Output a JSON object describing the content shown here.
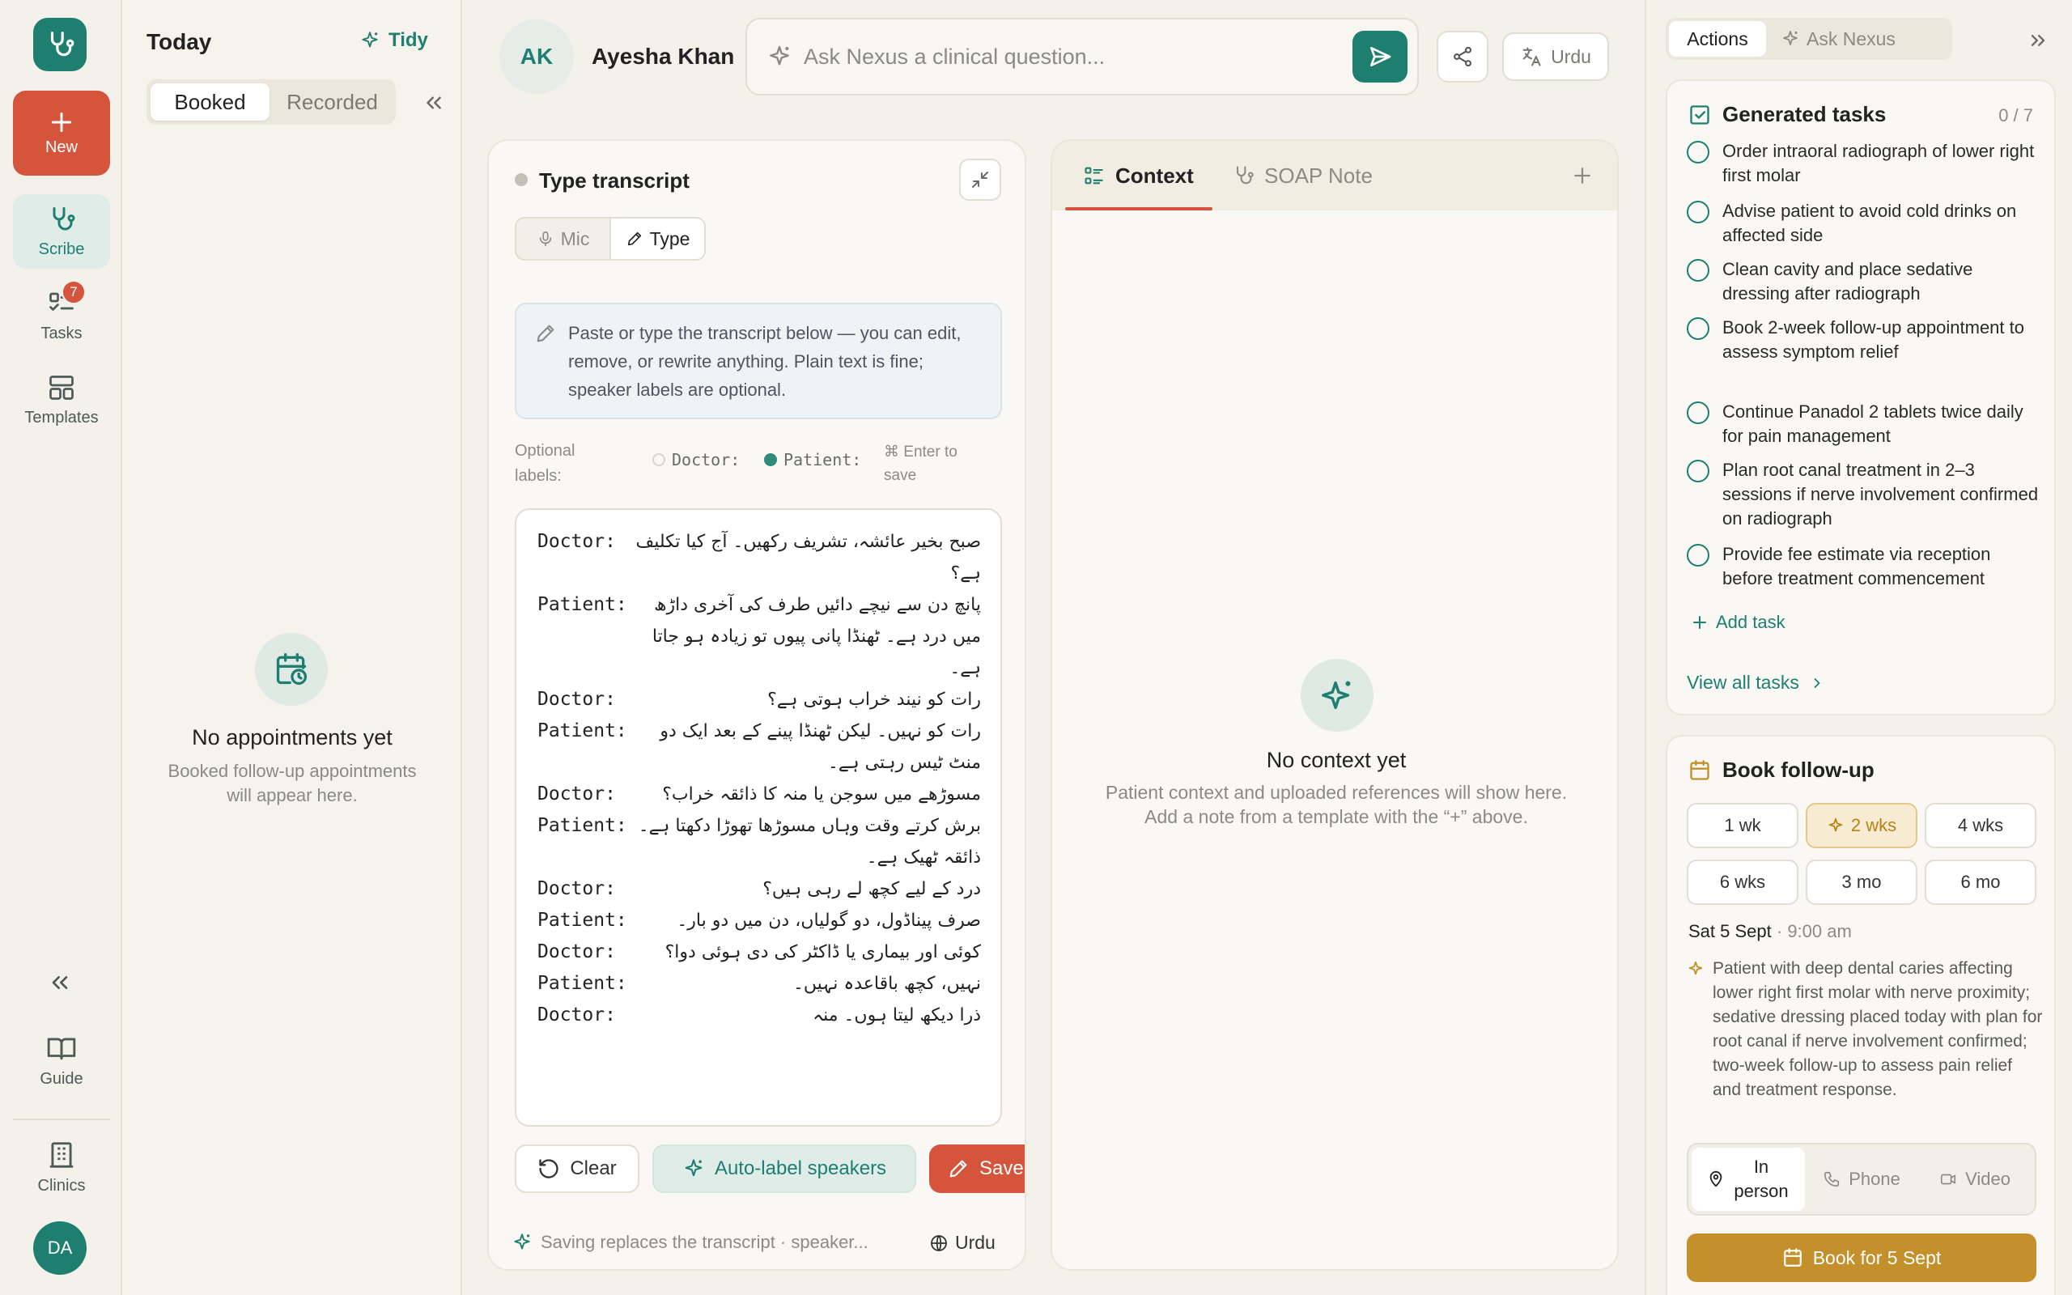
{
  "colors": {
    "brand": "#1e7f70",
    "accent": "#d4553b",
    "gold": "#c3902c",
    "background": "#f4f1ea"
  },
  "rail": {
    "new_label": "New",
    "items": [
      {
        "label": "Scribe",
        "icon": "stethoscope-icon",
        "active": true
      },
      {
        "label": "Tasks",
        "icon": "tasks-icon",
        "badge": "7"
      },
      {
        "label": "Templates",
        "icon": "templates-icon"
      }
    ],
    "guide_label": "Guide",
    "clinics_label": "Clinics",
    "user_initials": "DA"
  },
  "today": {
    "title": "Today",
    "tidy_label": "Tidy",
    "tabs": [
      "Booked",
      "Recorded"
    ],
    "selected_tab": "Booked",
    "empty_title": "No appointments yet",
    "empty_sub": "Booked follow-up appointments will appear here."
  },
  "header": {
    "patient_initials": "AK",
    "patient_name": "Ayesha Khan",
    "ask_placeholder": "Ask Nexus a clinical question...",
    "language": "Urdu"
  },
  "transcript": {
    "title": "Type transcript",
    "modes": [
      "Mic",
      "Type"
    ],
    "active_mode": "Type",
    "hint": "Paste or type the transcript below — you can edit, remove, or rewrite anything. Plain text is fine; speaker labels are optional.",
    "optional_labels": "Optional labels:",
    "label_doctor": "Doctor:",
    "label_patient": "Patient:",
    "save_shortcut": "⌘ Enter to save",
    "lines": [
      {
        "speaker": "Doctor:",
        "text": "صبح بخیر عائشہ، تشریف رکھیں۔ آج کیا تکلیف ہے؟"
      },
      {
        "speaker": "Patient:",
        "text": "پانچ دن سے نیچے دائیں طرف کی آخری داڑھ میں درد ہے۔ ٹھنڈا پانی پیوں تو زیادہ ہو جاتا ہے۔"
      },
      {
        "speaker": "Doctor:",
        "text": "رات کو نیند خراب ہوتی ہے؟"
      },
      {
        "speaker": "Patient:",
        "text": "رات کو نہیں۔ لیکن ٹھنڈا پینے کے بعد ایک دو منٹ ٹیس رہتی ہے۔"
      },
      {
        "speaker": "Doctor:",
        "text": "مسوڑھے میں سوجن یا منہ کا ذائقہ خراب؟"
      },
      {
        "speaker": "Patient:",
        "text": "برش کرتے وقت وہاں مسوڑھا تھوڑا دکھتا ہے۔ ذائقہ ٹھیک ہے۔"
      },
      {
        "speaker": "Doctor:",
        "text": "درد کے لیے کچھ لے رہی ہیں؟"
      },
      {
        "speaker": "Patient:",
        "text": "صرف پیناڈول، دو گولیاں، دن میں دو بار۔"
      },
      {
        "speaker": "Doctor:",
        "text": "کوئی اور بیماری یا ڈاکٹر کی دی ہوئی دوا؟"
      },
      {
        "speaker": "Patient:",
        "text": "نہیں، کچھ باقاعدہ نہیں۔"
      },
      {
        "speaker": "Doctor:",
        "text": "ذرا دیکھ لیتا ہوں۔ منہ"
      }
    ],
    "clear_label": "Clear",
    "auto_label": "Auto-label speakers",
    "save_label": "Save transcript",
    "footer_note": "Saving replaces the transcript · speaker...",
    "footer_lang": "Urdu"
  },
  "context": {
    "tabs": [
      "Context",
      "SOAP Note"
    ],
    "active_tab": "Context",
    "empty_title": "No context yet",
    "empty_sub_1": "Patient context and uploaded references will show here.",
    "empty_sub_2": "Add a note from a template with the “+” above."
  },
  "right": {
    "tabs": [
      "Actions",
      "Ask Nexus"
    ],
    "active_tab": "Actions",
    "tasks_title": "Generated tasks",
    "tasks_count": "0 / 7",
    "tasks": [
      "Order intraoral radiograph of lower right first molar",
      "Advise patient to avoid cold drinks on affected side",
      "Clean cavity and place sedative dressing after radiograph",
      "Book 2-week follow-up appointment to assess symptom relief",
      "Continue Panadol 2 tablets twice daily for pain management",
      "Plan root canal treatment in 2–3 sessions if nerve involvement confirmed on radiograph",
      "Provide fee estimate via reception before treatment commencement"
    ],
    "add_task": "Add task",
    "view_all": "View all tasks",
    "book_title": "Book follow-up",
    "intervals": [
      "1 wk",
      "2 wks",
      "4 wks",
      "6 wks",
      "3 mo",
      "6 mo"
    ],
    "selected_interval": "2 wks",
    "date": "Sat 5 Sept",
    "time": "9:00 am",
    "note": "Patient with deep dental caries affecting lower right first molar with nerve proximity; sedative dressing placed today with plan for root canal if nerve involvement confirmed; two-week follow-up to assess pain relief and treatment response.",
    "visit_types": [
      "In person",
      "Phone",
      "Video"
    ],
    "selected_visit": "In person",
    "book_button": "Book for 5 Sept"
  }
}
